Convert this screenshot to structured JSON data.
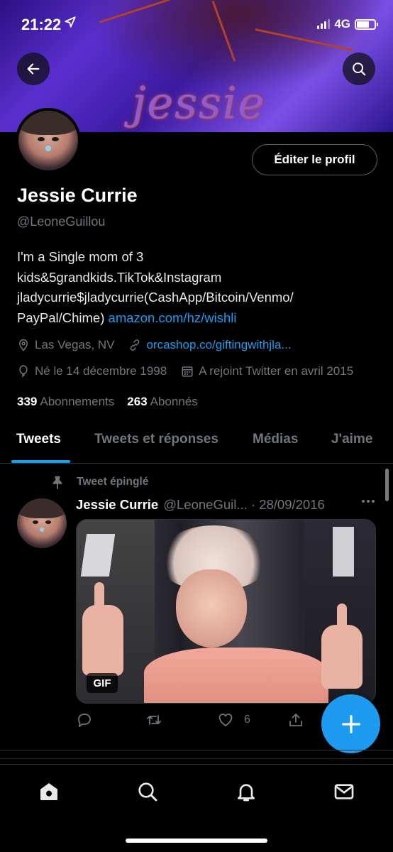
{
  "status_bar": {
    "time": "21:22",
    "network": "4G"
  },
  "banner": {
    "title": "jessie"
  },
  "profile": {
    "edit_button": "Éditer le profil",
    "name": "Jessie Currie",
    "handle": "@LeoneGuillou",
    "bio_line1": "I'm a Single mom of 3",
    "bio_line2": "kids&5grandkids.TikTok&Instagram",
    "bio_line3": "jladycurrie$jladycurrie(CashApp/Bitcoin/Venmo/",
    "bio_line4_text": "PayPal/Chime)",
    "bio_link": "amazon.com/hz/wishli",
    "location": "Las Vegas, NV",
    "website": "orcashop.co/giftingwithjla...",
    "birthday": "Né le 14 décembre 1998",
    "joined": "A rejoint Twitter en avril 2015",
    "following_count": "339",
    "following_label": "Abonnements",
    "followers_count": "263",
    "followers_label": "Abonnés"
  },
  "tabs": [
    {
      "label": "Tweets",
      "active": true
    },
    {
      "label": "Tweets et réponses",
      "active": false
    },
    {
      "label": "Médias",
      "active": false
    },
    {
      "label": "J'aime",
      "active": false
    }
  ],
  "tweet": {
    "pinned_label": "Tweet épinglé",
    "author_name": "Jessie Currie",
    "author_handle_date": "@LeoneGuil... · 28/09/2016",
    "media_badge": "GIF",
    "like_count": "6"
  },
  "icons": {
    "back": "arrow-left-icon",
    "search": "search-icon",
    "location": "location-pin-icon",
    "link": "link-icon",
    "birthday": "balloon-icon",
    "calendar": "calendar-icon",
    "pin": "pin-icon",
    "reply": "reply-icon",
    "retweet": "retweet-icon",
    "like": "heart-icon",
    "share": "share-icon",
    "compose": "plus-icon",
    "nav_home": "home-icon",
    "nav_search": "search-icon",
    "nav_notifications": "bell-icon",
    "nav_messages": "mail-icon"
  },
  "colors": {
    "accent": "#1d9bf0",
    "muted": "#71767b",
    "background": "#000000"
  }
}
